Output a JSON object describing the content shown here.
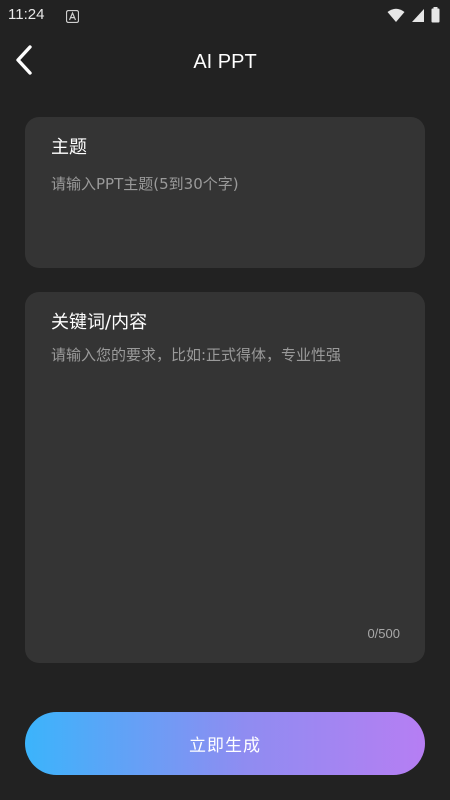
{
  "status_bar": {
    "time": "11:24",
    "icons": [
      "notification-a-icon",
      "wifi-icon",
      "cellular-signal-icon",
      "battery-icon"
    ]
  },
  "header": {
    "title": "AI PPT",
    "back_icon": "chevron-left-icon"
  },
  "topic_card": {
    "label": "主题",
    "placeholder": "请输入PPT主题(5到30个字)",
    "value": ""
  },
  "keywords_card": {
    "label": "关键词/内容",
    "placeholder": "请输入您的要求，比如:正式得体，专业性强",
    "value": "",
    "counter": "0/500"
  },
  "generate_button": {
    "label": "立即生成"
  },
  "colors": {
    "background": "#222222",
    "card": "#343434",
    "gradient_start": "#3bb4fb",
    "gradient_end": "#b67ef3",
    "placeholder": "#9a9a9a"
  }
}
